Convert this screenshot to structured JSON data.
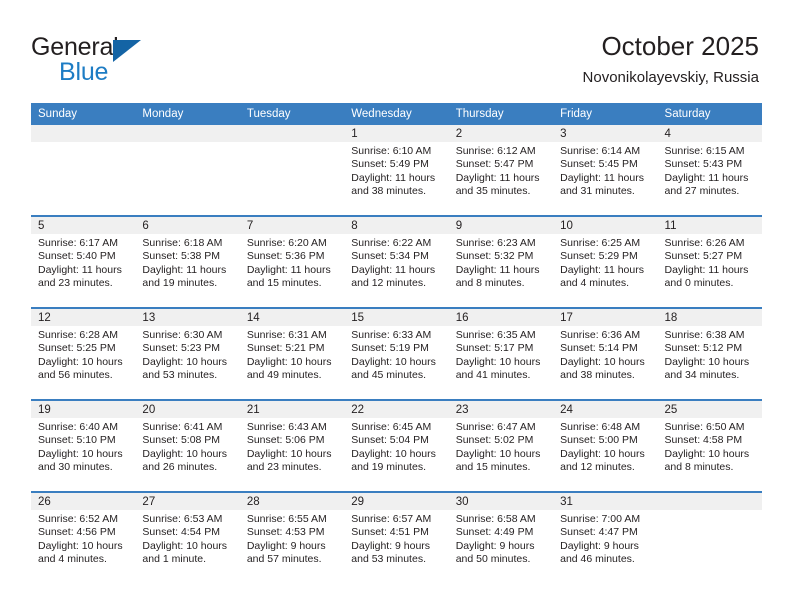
{
  "brand": {
    "name_part1": "General",
    "name_part2": "Blue",
    "logo_icon": "triangle-logo-icon"
  },
  "header": {
    "title": "October 2025",
    "subtitle": "Novonikolayevskiy, Russia"
  },
  "colors": {
    "header_blue": "#3a7ec0",
    "brand_blue": "#1d7cc4",
    "logo_blue": "#1464a5",
    "daynum_band": "#f0f0f0",
    "text": "#231f20"
  },
  "weekday_headers": [
    "Sunday",
    "Monday",
    "Tuesday",
    "Wednesday",
    "Thursday",
    "Friday",
    "Saturday"
  ],
  "weeks": [
    [
      {
        "day": "",
        "sunrise": "",
        "sunset": "",
        "daylight1": "",
        "daylight2": "",
        "empty": true
      },
      {
        "day": "",
        "sunrise": "",
        "sunset": "",
        "daylight1": "",
        "daylight2": "",
        "empty": true
      },
      {
        "day": "",
        "sunrise": "",
        "sunset": "",
        "daylight1": "",
        "daylight2": "",
        "empty": true
      },
      {
        "day": "1",
        "sunrise": "Sunrise: 6:10 AM",
        "sunset": "Sunset: 5:49 PM",
        "daylight1": "Daylight: 11 hours",
        "daylight2": "and 38 minutes."
      },
      {
        "day": "2",
        "sunrise": "Sunrise: 6:12 AM",
        "sunset": "Sunset: 5:47 PM",
        "daylight1": "Daylight: 11 hours",
        "daylight2": "and 35 minutes."
      },
      {
        "day": "3",
        "sunrise": "Sunrise: 6:14 AM",
        "sunset": "Sunset: 5:45 PM",
        "daylight1": "Daylight: 11 hours",
        "daylight2": "and 31 minutes."
      },
      {
        "day": "4",
        "sunrise": "Sunrise: 6:15 AM",
        "sunset": "Sunset: 5:43 PM",
        "daylight1": "Daylight: 11 hours",
        "daylight2": "and 27 minutes."
      }
    ],
    [
      {
        "day": "5",
        "sunrise": "Sunrise: 6:17 AM",
        "sunset": "Sunset: 5:40 PM",
        "daylight1": "Daylight: 11 hours",
        "daylight2": "and 23 minutes."
      },
      {
        "day": "6",
        "sunrise": "Sunrise: 6:18 AM",
        "sunset": "Sunset: 5:38 PM",
        "daylight1": "Daylight: 11 hours",
        "daylight2": "and 19 minutes."
      },
      {
        "day": "7",
        "sunrise": "Sunrise: 6:20 AM",
        "sunset": "Sunset: 5:36 PM",
        "daylight1": "Daylight: 11 hours",
        "daylight2": "and 15 minutes."
      },
      {
        "day": "8",
        "sunrise": "Sunrise: 6:22 AM",
        "sunset": "Sunset: 5:34 PM",
        "daylight1": "Daylight: 11 hours",
        "daylight2": "and 12 minutes."
      },
      {
        "day": "9",
        "sunrise": "Sunrise: 6:23 AM",
        "sunset": "Sunset: 5:32 PM",
        "daylight1": "Daylight: 11 hours",
        "daylight2": "and 8 minutes."
      },
      {
        "day": "10",
        "sunrise": "Sunrise: 6:25 AM",
        "sunset": "Sunset: 5:29 PM",
        "daylight1": "Daylight: 11 hours",
        "daylight2": "and 4 minutes."
      },
      {
        "day": "11",
        "sunrise": "Sunrise: 6:26 AM",
        "sunset": "Sunset: 5:27 PM",
        "daylight1": "Daylight: 11 hours",
        "daylight2": "and 0 minutes."
      }
    ],
    [
      {
        "day": "12",
        "sunrise": "Sunrise: 6:28 AM",
        "sunset": "Sunset: 5:25 PM",
        "daylight1": "Daylight: 10 hours",
        "daylight2": "and 56 minutes."
      },
      {
        "day": "13",
        "sunrise": "Sunrise: 6:30 AM",
        "sunset": "Sunset: 5:23 PM",
        "daylight1": "Daylight: 10 hours",
        "daylight2": "and 53 minutes."
      },
      {
        "day": "14",
        "sunrise": "Sunrise: 6:31 AM",
        "sunset": "Sunset: 5:21 PM",
        "daylight1": "Daylight: 10 hours",
        "daylight2": "and 49 minutes."
      },
      {
        "day": "15",
        "sunrise": "Sunrise: 6:33 AM",
        "sunset": "Sunset: 5:19 PM",
        "daylight1": "Daylight: 10 hours",
        "daylight2": "and 45 minutes."
      },
      {
        "day": "16",
        "sunrise": "Sunrise: 6:35 AM",
        "sunset": "Sunset: 5:17 PM",
        "daylight1": "Daylight: 10 hours",
        "daylight2": "and 41 minutes."
      },
      {
        "day": "17",
        "sunrise": "Sunrise: 6:36 AM",
        "sunset": "Sunset: 5:14 PM",
        "daylight1": "Daylight: 10 hours",
        "daylight2": "and 38 minutes."
      },
      {
        "day": "18",
        "sunrise": "Sunrise: 6:38 AM",
        "sunset": "Sunset: 5:12 PM",
        "daylight1": "Daylight: 10 hours",
        "daylight2": "and 34 minutes."
      }
    ],
    [
      {
        "day": "19",
        "sunrise": "Sunrise: 6:40 AM",
        "sunset": "Sunset: 5:10 PM",
        "daylight1": "Daylight: 10 hours",
        "daylight2": "and 30 minutes."
      },
      {
        "day": "20",
        "sunrise": "Sunrise: 6:41 AM",
        "sunset": "Sunset: 5:08 PM",
        "daylight1": "Daylight: 10 hours",
        "daylight2": "and 26 minutes."
      },
      {
        "day": "21",
        "sunrise": "Sunrise: 6:43 AM",
        "sunset": "Sunset: 5:06 PM",
        "daylight1": "Daylight: 10 hours",
        "daylight2": "and 23 minutes."
      },
      {
        "day": "22",
        "sunrise": "Sunrise: 6:45 AM",
        "sunset": "Sunset: 5:04 PM",
        "daylight1": "Daylight: 10 hours",
        "daylight2": "and 19 minutes."
      },
      {
        "day": "23",
        "sunrise": "Sunrise: 6:47 AM",
        "sunset": "Sunset: 5:02 PM",
        "daylight1": "Daylight: 10 hours",
        "daylight2": "and 15 minutes."
      },
      {
        "day": "24",
        "sunrise": "Sunrise: 6:48 AM",
        "sunset": "Sunset: 5:00 PM",
        "daylight1": "Daylight: 10 hours",
        "daylight2": "and 12 minutes."
      },
      {
        "day": "25",
        "sunrise": "Sunrise: 6:50 AM",
        "sunset": "Sunset: 4:58 PM",
        "daylight1": "Daylight: 10 hours",
        "daylight2": "and 8 minutes."
      }
    ],
    [
      {
        "day": "26",
        "sunrise": "Sunrise: 6:52 AM",
        "sunset": "Sunset: 4:56 PM",
        "daylight1": "Daylight: 10 hours",
        "daylight2": "and 4 minutes."
      },
      {
        "day": "27",
        "sunrise": "Sunrise: 6:53 AM",
        "sunset": "Sunset: 4:54 PM",
        "daylight1": "Daylight: 10 hours",
        "daylight2": "and 1 minute."
      },
      {
        "day": "28",
        "sunrise": "Sunrise: 6:55 AM",
        "sunset": "Sunset: 4:53 PM",
        "daylight1": "Daylight: 9 hours",
        "daylight2": "and 57 minutes."
      },
      {
        "day": "29",
        "sunrise": "Sunrise: 6:57 AM",
        "sunset": "Sunset: 4:51 PM",
        "daylight1": "Daylight: 9 hours",
        "daylight2": "and 53 minutes."
      },
      {
        "day": "30",
        "sunrise": "Sunrise: 6:58 AM",
        "sunset": "Sunset: 4:49 PM",
        "daylight1": "Daylight: 9 hours",
        "daylight2": "and 50 minutes."
      },
      {
        "day": "31",
        "sunrise": "Sunrise: 7:00 AM",
        "sunset": "Sunset: 4:47 PM",
        "daylight1": "Daylight: 9 hours",
        "daylight2": "and 46 minutes."
      },
      {
        "day": "",
        "sunrise": "",
        "sunset": "",
        "daylight1": "",
        "daylight2": "",
        "empty": true
      }
    ]
  ]
}
